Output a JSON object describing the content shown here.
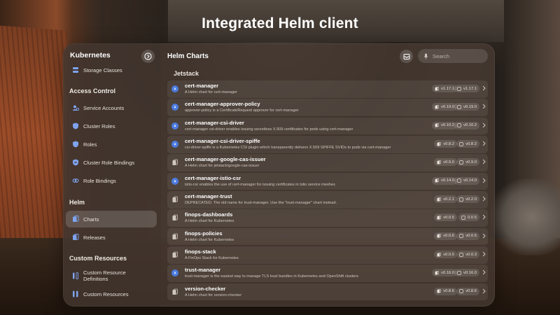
{
  "headline": "Integrated Helm client",
  "sidebar": {
    "title": "Kubernetes",
    "top_item": "Storage Classes",
    "sections": {
      "access_control": "Access Control",
      "helm": "Helm",
      "custom_resources": "Custom Resources"
    },
    "access_control_items": [
      "Service Accounts",
      "Cluster Roles",
      "Roles",
      "Cluster Role Bindings",
      "Role Bindings"
    ],
    "helm_items": [
      "Charts",
      "Releases"
    ],
    "custom_resources_items": [
      "Custom Resource Definitions",
      "Custom Resources"
    ],
    "active_item": "Charts"
  },
  "main": {
    "title": "Helm Charts",
    "search_placeholder": "Search",
    "group": "Jetstack",
    "charts": [
      {
        "name": "cert-manager",
        "description": "A Helm chart for cert-manager",
        "chart_version": "v1.17.1",
        "app_version": "v1.17.1",
        "icon": "blue"
      },
      {
        "name": "cert-manager-approver-policy",
        "description": "approver-policy is a CertificateRequest approver for cert-manager",
        "chart_version": "v0.19.0",
        "app_version": "v0.19.0",
        "icon": "blue"
      },
      {
        "name": "cert-manager-csi-driver",
        "description": "cert-manager csi-driver enables issuing secretless X.509 certificates for pods using cert-manager",
        "chart_version": "v0.10.2",
        "app_version": "v0.10.2",
        "icon": "blue"
      },
      {
        "name": "cert-manager-csi-driver-spiffe",
        "description": "csi-driver-spiffe is a Kubernetes CSI plugin which transparently delivers X.509 SPIFFE SVIDs to pods via cert-manager",
        "chart_version": "v0.8.2",
        "app_version": "v0.8.2",
        "icon": "blue"
      },
      {
        "name": "cert-manager-google-cas-issuer",
        "description": "A Helm chart for jetstack/google-cas-issuer",
        "chart_version": "v0.9.0",
        "app_version": "v0.9.0",
        "icon": "doc"
      },
      {
        "name": "cert-manager-istio-csr",
        "description": "istio-csr enables the use of cert-manager for issuing certificates in Istio service meshes",
        "chart_version": "v0.14.0",
        "app_version": "v0.14.0",
        "icon": "blue"
      },
      {
        "name": "cert-manager-trust",
        "description": "DEPRECATED: The old name for trust-manager. Use the \"trust-manager\" chart instead.",
        "chart_version": "v0.2.1",
        "app_version": "v0.2.0",
        "icon": "doc"
      },
      {
        "name": "finops-dashboards",
        "description": "A Helm chart for Kubernetes",
        "chart_version": "v0.0.5",
        "app_version": "0.0.5",
        "icon": "doc"
      },
      {
        "name": "finops-policies",
        "description": "A Helm chart for Kubernetes",
        "chart_version": "v0.0.6",
        "app_version": "v0.0.6",
        "icon": "doc"
      },
      {
        "name": "finops-stack",
        "description": "A FinOps Stack for Kubernetes",
        "chart_version": "v0.0.5",
        "app_version": "v0.0.3",
        "icon": "doc"
      },
      {
        "name": "trust-manager",
        "description": "trust-manager is the easiest way to manage TLS trust bundles in Kubernetes and OpenShift clusters",
        "chart_version": "v0.16.0",
        "app_version": "v0.16.0",
        "icon": "blue"
      },
      {
        "name": "version-checker",
        "description": "A Helm chart for version-checker",
        "chart_version": "v0.8.6",
        "app_version": "v0.8.6",
        "icon": "doc"
      }
    ]
  },
  "colors": {
    "accent_blue": "#4c7be0",
    "panel": "#463a32"
  }
}
